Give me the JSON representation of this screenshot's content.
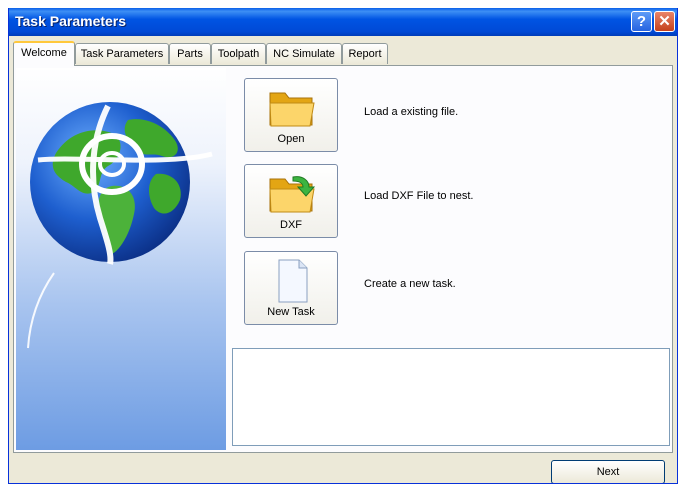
{
  "window": {
    "title": "Task Parameters",
    "help_icon": "?",
    "close_icon": "✕"
  },
  "tabs": [
    {
      "label": "Welcome",
      "active": true
    },
    {
      "label": "Task Parameters",
      "active": false
    },
    {
      "label": "Parts",
      "active": false
    },
    {
      "label": "Toolpath",
      "active": false
    },
    {
      "label": "NC Simulate",
      "active": false
    },
    {
      "label": "Report",
      "active": false
    }
  ],
  "welcome": {
    "graphic": "globe-icon",
    "actions": [
      {
        "label": "Open",
        "description": "Load a existing file.",
        "icon": "folder-open-icon"
      },
      {
        "label": "DXF",
        "description": "Load DXF File to nest.",
        "icon": "folder-import-icon"
      },
      {
        "label": "New Task",
        "description": "Create a new task.",
        "icon": "new-document-icon"
      }
    ],
    "message": ""
  },
  "footer": {
    "next_label": "Next"
  },
  "colors": {
    "titlebar": "#0054e3",
    "dialog_bg": "#ece9d8",
    "tab_highlight": "#ffc83c",
    "sidebar_gradient_bottom": "#6d9ce3"
  }
}
